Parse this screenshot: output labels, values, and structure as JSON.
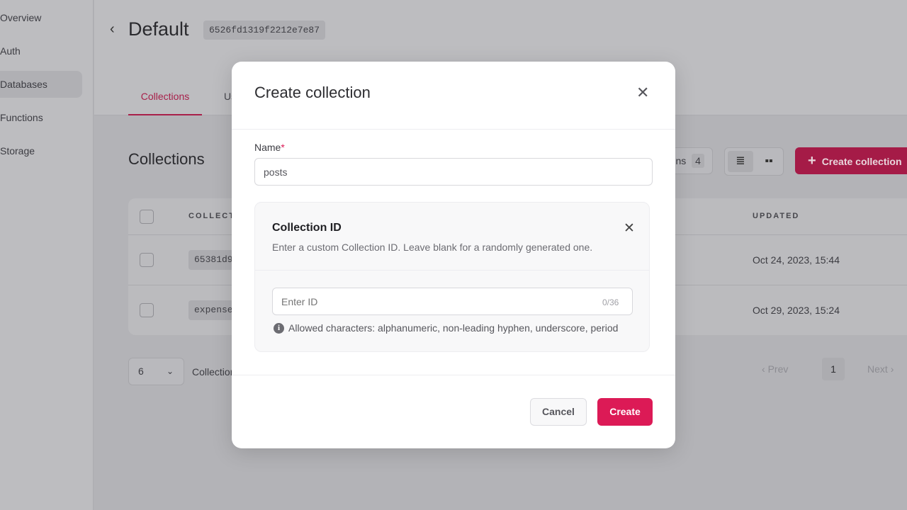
{
  "sidebar": {
    "items": [
      {
        "label": "Overview"
      },
      {
        "label": "Auth"
      },
      {
        "label": "Databases",
        "active": true
      },
      {
        "label": "Functions"
      },
      {
        "label": "Storage"
      }
    ]
  },
  "header": {
    "title": "Default",
    "database_id": "6526fd1319f2212e7e87",
    "tabs": [
      {
        "label": "Collections",
        "active": true
      },
      {
        "label": "Usage"
      }
    ]
  },
  "main": {
    "heading": "Collections",
    "columns_button": {
      "label": "Columns",
      "count": "4"
    },
    "create_button": "Create collection",
    "table": {
      "headers": [
        "COLLECTION ID",
        "UPDATED"
      ],
      "rows": [
        {
          "id": "65381d9",
          "updated": "Oct 24, 2023, 15:44"
        },
        {
          "id": "expense",
          "updated": "Oct 29, 2023, 15:24"
        }
      ]
    },
    "pagination": {
      "per_page": "6",
      "per_page_label": "Collections per page",
      "prev": "Prev",
      "page": "1",
      "next": "Next"
    }
  },
  "modal": {
    "title": "Create collection",
    "name_label": "Name",
    "required_mark": "*",
    "name_value": "posts",
    "id_card": {
      "title": "Collection ID",
      "description": "Enter a custom Collection ID. Leave blank for a randomly generated one.",
      "placeholder": "Enter ID",
      "counter": "0/36",
      "hint": "Allowed characters: alphanumeric, non-leading hyphen, underscore, period"
    },
    "cancel": "Cancel",
    "create": "Create"
  },
  "colors": {
    "accent": "#dc1a56",
    "overlay": "#b3b3b7"
  }
}
